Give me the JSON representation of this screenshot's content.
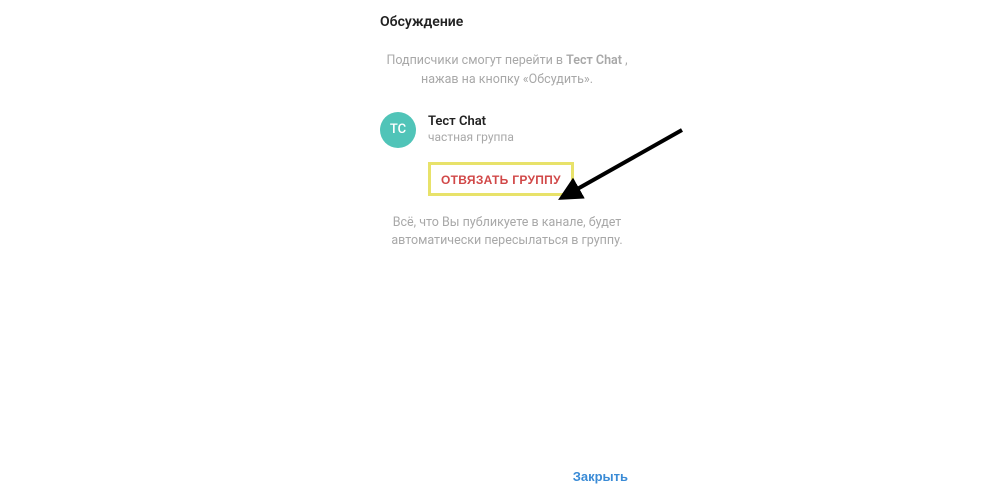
{
  "dialog": {
    "title": "Обсуждение",
    "description_top_prefix": "Подписчики смогут перейти в ",
    "description_top_bold": "Тест Chat",
    "description_top_suffix": " , нажав на кнопку «Обсудить».",
    "chat": {
      "avatar_initials": "TC",
      "name": "Тест Chat",
      "type": "частная группа"
    },
    "unlink_label": "ОТВЯЗАТЬ ГРУППУ",
    "description_bottom": "Всё, что Вы публикуете в канале, будет автоматически пересылаться в группу.",
    "close_label": "Закрыть"
  },
  "colors": {
    "avatar_bg": "#50c4b8",
    "highlight_border": "#e8e26a",
    "unlink_text": "#d14848",
    "close_text": "#3a8bd6"
  }
}
